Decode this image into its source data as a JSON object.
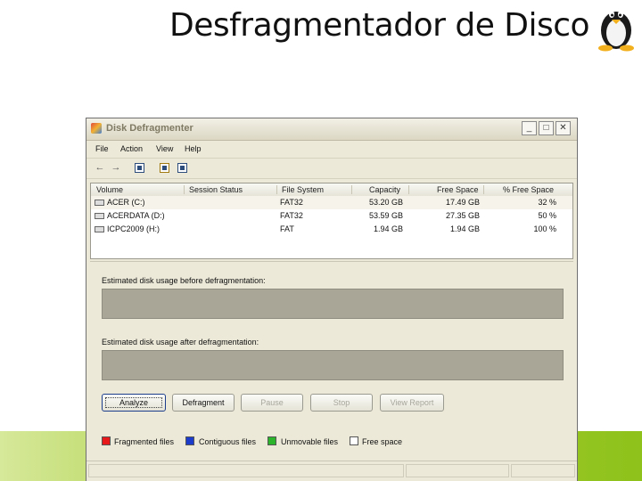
{
  "slide": {
    "title": "Desfragmentador de Disco"
  },
  "window": {
    "title": "Disk Defragmenter",
    "controls": {
      "minimize": "_",
      "maximize": "□",
      "close": "✕"
    }
  },
  "menu": [
    "File",
    "Action",
    "View",
    "Help"
  ],
  "toolbar": {
    "back_icon": "back-arrow-icon",
    "forward_icon": "forward-arrow-icon"
  },
  "list": {
    "columns": [
      "Volume",
      "Session Status",
      "File System",
      "Capacity",
      "Free Space",
      "% Free Space"
    ],
    "rows": [
      {
        "volume": "ACER (C:)",
        "status": "",
        "fs": "FAT32",
        "capacity": "53.20 GB",
        "free": "17.49 GB",
        "pct": "32 %"
      },
      {
        "volume": "ACERDATA (D:)",
        "status": "",
        "fs": "FAT32",
        "capacity": "53.59 GB",
        "free": "27.35 GB",
        "pct": "50 %"
      },
      {
        "volume": "ICPC2009 (H:)",
        "status": "",
        "fs": "FAT",
        "capacity": "1.94 GB",
        "free": "1.94 GB",
        "pct": "100 %"
      }
    ]
  },
  "usage": {
    "before_label": "Estimated disk usage before defragmentation:",
    "after_label": "Estimated disk usage after defragmentation:"
  },
  "buttons": {
    "analyze": "Analyze",
    "defragment": "Defragment",
    "pause": "Pause",
    "stop": "Stop",
    "view_report": "View Report"
  },
  "legend": [
    {
      "label": "Fragmented files",
      "color": "#e8191b"
    },
    {
      "label": "Contiguous files",
      "color": "#1c3ccc"
    },
    {
      "label": "Unmovable files",
      "color": "#2cb52c"
    },
    {
      "label": "Free space",
      "color": "#ffffff"
    }
  ],
  "colors": {
    "footer_green": "#8fc21b",
    "window_bg": "#ece9d8"
  }
}
